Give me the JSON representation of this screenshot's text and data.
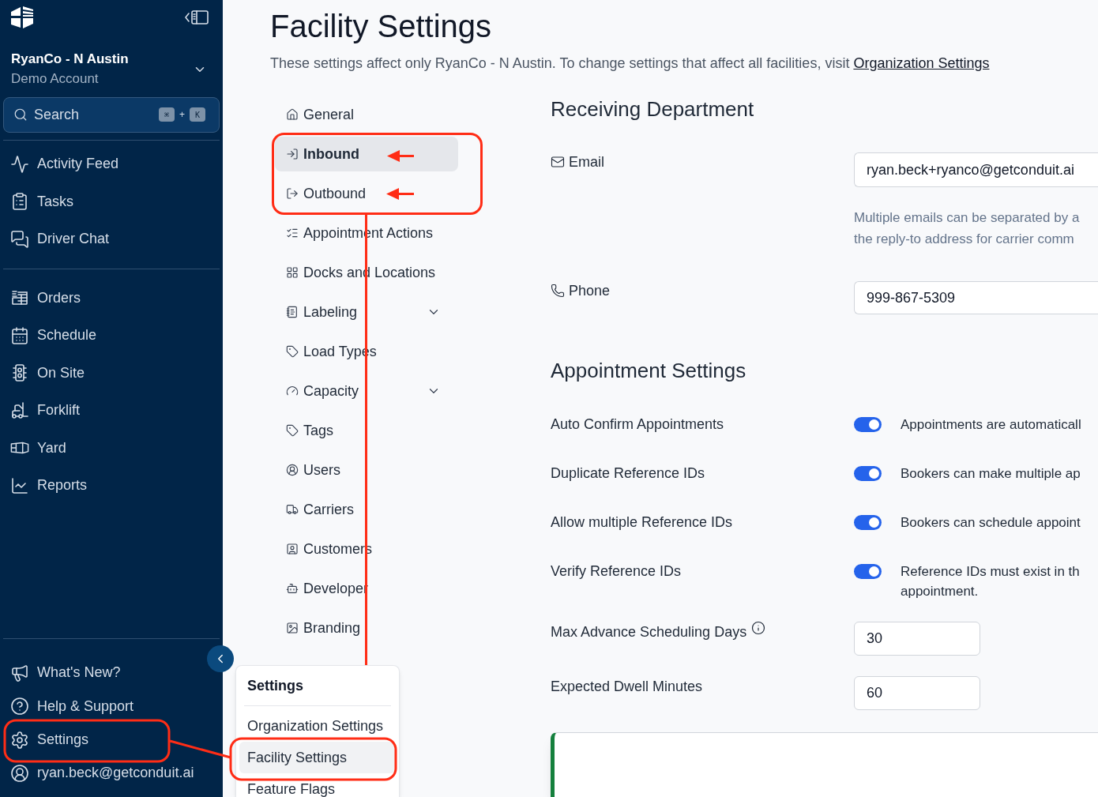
{
  "sidebar": {
    "account": {
      "name": "RyanCo - N Austin",
      "subtitle": "Demo Account"
    },
    "search": {
      "placeholder": "Search",
      "shortcut": [
        {
          "kind": "key",
          "text": "⌘"
        },
        {
          "kind": "separator",
          "text": "+"
        },
        {
          "kind": "key",
          "text": "K"
        }
      ]
    },
    "nav_groups": [
      [
        "Activity Feed",
        "Tasks",
        "Driver Chat"
      ],
      [
        "Orders",
        "Schedule",
        "On Site",
        "Forklift",
        "Yard",
        "Reports"
      ]
    ],
    "footer_items": [
      "What's New?",
      "Help & Support",
      "Settings",
      "ryan.beck@getconduit.ai"
    ]
  },
  "page": {
    "title": "Facility Settings",
    "description": {
      "text": "These settings affect only RyanCo - N Austin. To change settings that affect all facilities, visit",
      "link": "Organization Settings"
    }
  },
  "settings_nav": {
    "items": [
      {
        "label": "General",
        "kind": "link",
        "selected": false
      },
      {
        "label": "Inbound",
        "kind": "link",
        "selected": true
      },
      {
        "label": "Outbound",
        "kind": "link",
        "selected": false
      },
      {
        "label": "Appointment Actions",
        "kind": "link",
        "selected": false
      },
      {
        "label": "Docks and Locations",
        "kind": "link",
        "selected": false
      },
      {
        "label": "Labeling",
        "kind": "group",
        "selected": false,
        "expanded": false
      },
      {
        "label": "Load Types",
        "kind": "link",
        "selected": false
      },
      {
        "label": "Capacity",
        "kind": "group",
        "selected": false,
        "expanded": false
      },
      {
        "label": "Tags",
        "kind": "link",
        "selected": false
      },
      {
        "label": "Users",
        "kind": "link",
        "selected": false
      },
      {
        "label": "Carriers",
        "kind": "link",
        "selected": false
      },
      {
        "label": "Customers",
        "kind": "link",
        "selected": false
      },
      {
        "label": "Developer",
        "kind": "link",
        "selected": false
      },
      {
        "label": "Branding",
        "kind": "link",
        "selected": false
      }
    ]
  },
  "receiving_department": {
    "heading": "Receiving Department",
    "fields": [
      {
        "label": "Email",
        "value": "ryan.beck+ryanco@getconduit.ai",
        "help_lines": [
          "Multiple emails can be separated by a",
          "the reply-to address for carrier comm"
        ]
      },
      {
        "label": "Phone",
        "value": "999-867-5309"
      }
    ]
  },
  "appointment_settings": {
    "heading": "Appointment Settings",
    "rows": [
      {
        "kind": "toggle",
        "label": "Auto Confirm Appointments",
        "on": true,
        "description_lines": [
          "Appointments are automaticall"
        ]
      },
      {
        "kind": "toggle",
        "label": "Duplicate Reference IDs",
        "on": true,
        "description_lines": [
          "Bookers can make multiple ap"
        ]
      },
      {
        "kind": "toggle",
        "label": "Allow multiple Reference IDs",
        "on": true,
        "description_lines": [
          "Bookers can schedule appoint"
        ]
      },
      {
        "kind": "toggle",
        "label": "Verify Reference IDs",
        "on": true,
        "description_lines": [
          "Reference IDs must exist in th",
          "appointment."
        ]
      },
      {
        "kind": "number",
        "label": "Max Advance Scheduling Days",
        "info": true,
        "value": "30"
      },
      {
        "kind": "number",
        "label": "Expected Dwell Minutes",
        "info": false,
        "value": "60"
      }
    ]
  },
  "settings_menu": {
    "title": "Settings",
    "items": [
      {
        "label": "Organization Settings",
        "selected": false
      },
      {
        "label": "Facility Settings",
        "selected": true
      },
      {
        "label": "Feature Flags",
        "selected": false
      }
    ]
  },
  "toast": {
    "kind": "success"
  }
}
